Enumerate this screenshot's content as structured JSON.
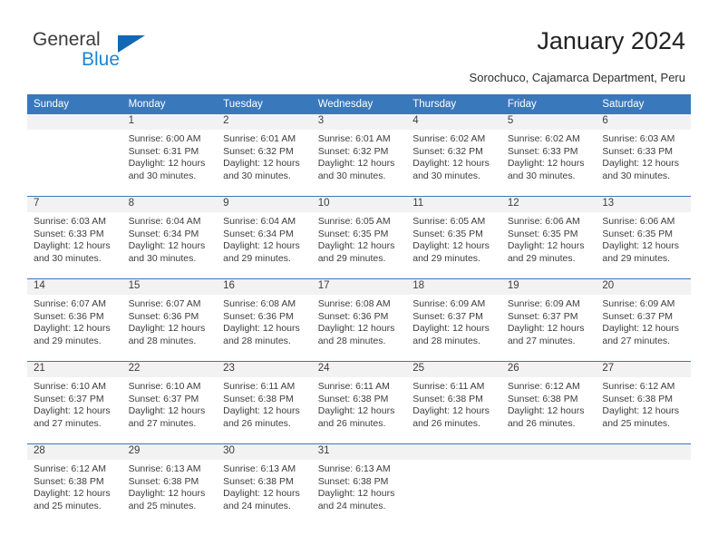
{
  "brand": {
    "name_part1": "General",
    "name_part2": "Blue",
    "triangle_color": "#1268b3",
    "blue_color": "#1c86d6"
  },
  "header": {
    "title": "January 2024",
    "subtitle": "Sorochuco, Cajamarca Department, Peru",
    "header_bg": "#3a78bc"
  },
  "calendar": {
    "weekday_headers": [
      "Sunday",
      "Monday",
      "Tuesday",
      "Wednesday",
      "Thursday",
      "Friday",
      "Saturday"
    ],
    "weeks": [
      [
        {
          "day": "",
          "sunrise": "",
          "sunset": "",
          "daylight": "",
          "daylight2": ""
        },
        {
          "day": "1",
          "sunrise": "Sunrise: 6:00 AM",
          "sunset": "Sunset: 6:31 PM",
          "daylight": "Daylight: 12 hours",
          "daylight2": "and 30 minutes."
        },
        {
          "day": "2",
          "sunrise": "Sunrise: 6:01 AM",
          "sunset": "Sunset: 6:32 PM",
          "daylight": "Daylight: 12 hours",
          "daylight2": "and 30 minutes."
        },
        {
          "day": "3",
          "sunrise": "Sunrise: 6:01 AM",
          "sunset": "Sunset: 6:32 PM",
          "daylight": "Daylight: 12 hours",
          "daylight2": "and 30 minutes."
        },
        {
          "day": "4",
          "sunrise": "Sunrise: 6:02 AM",
          "sunset": "Sunset: 6:32 PM",
          "daylight": "Daylight: 12 hours",
          "daylight2": "and 30 minutes."
        },
        {
          "day": "5",
          "sunrise": "Sunrise: 6:02 AM",
          "sunset": "Sunset: 6:33 PM",
          "daylight": "Daylight: 12 hours",
          "daylight2": "and 30 minutes."
        },
        {
          "day": "6",
          "sunrise": "Sunrise: 6:03 AM",
          "sunset": "Sunset: 6:33 PM",
          "daylight": "Daylight: 12 hours",
          "daylight2": "and 30 minutes."
        }
      ],
      [
        {
          "day": "7",
          "sunrise": "Sunrise: 6:03 AM",
          "sunset": "Sunset: 6:33 PM",
          "daylight": "Daylight: 12 hours",
          "daylight2": "and 30 minutes."
        },
        {
          "day": "8",
          "sunrise": "Sunrise: 6:04 AM",
          "sunset": "Sunset: 6:34 PM",
          "daylight": "Daylight: 12 hours",
          "daylight2": "and 30 minutes."
        },
        {
          "day": "9",
          "sunrise": "Sunrise: 6:04 AM",
          "sunset": "Sunset: 6:34 PM",
          "daylight": "Daylight: 12 hours",
          "daylight2": "and 29 minutes."
        },
        {
          "day": "10",
          "sunrise": "Sunrise: 6:05 AM",
          "sunset": "Sunset: 6:35 PM",
          "daylight": "Daylight: 12 hours",
          "daylight2": "and 29 minutes."
        },
        {
          "day": "11",
          "sunrise": "Sunrise: 6:05 AM",
          "sunset": "Sunset: 6:35 PM",
          "daylight": "Daylight: 12 hours",
          "daylight2": "and 29 minutes."
        },
        {
          "day": "12",
          "sunrise": "Sunrise: 6:06 AM",
          "sunset": "Sunset: 6:35 PM",
          "daylight": "Daylight: 12 hours",
          "daylight2": "and 29 minutes."
        },
        {
          "day": "13",
          "sunrise": "Sunrise: 6:06 AM",
          "sunset": "Sunset: 6:35 PM",
          "daylight": "Daylight: 12 hours",
          "daylight2": "and 29 minutes."
        }
      ],
      [
        {
          "day": "14",
          "sunrise": "Sunrise: 6:07 AM",
          "sunset": "Sunset: 6:36 PM",
          "daylight": "Daylight: 12 hours",
          "daylight2": "and 29 minutes."
        },
        {
          "day": "15",
          "sunrise": "Sunrise: 6:07 AM",
          "sunset": "Sunset: 6:36 PM",
          "daylight": "Daylight: 12 hours",
          "daylight2": "and 28 minutes."
        },
        {
          "day": "16",
          "sunrise": "Sunrise: 6:08 AM",
          "sunset": "Sunset: 6:36 PM",
          "daylight": "Daylight: 12 hours",
          "daylight2": "and 28 minutes."
        },
        {
          "day": "17",
          "sunrise": "Sunrise: 6:08 AM",
          "sunset": "Sunset: 6:36 PM",
          "daylight": "Daylight: 12 hours",
          "daylight2": "and 28 minutes."
        },
        {
          "day": "18",
          "sunrise": "Sunrise: 6:09 AM",
          "sunset": "Sunset: 6:37 PM",
          "daylight": "Daylight: 12 hours",
          "daylight2": "and 28 minutes."
        },
        {
          "day": "19",
          "sunrise": "Sunrise: 6:09 AM",
          "sunset": "Sunset: 6:37 PM",
          "daylight": "Daylight: 12 hours",
          "daylight2": "and 27 minutes."
        },
        {
          "day": "20",
          "sunrise": "Sunrise: 6:09 AM",
          "sunset": "Sunset: 6:37 PM",
          "daylight": "Daylight: 12 hours",
          "daylight2": "and 27 minutes."
        }
      ],
      [
        {
          "day": "21",
          "sunrise": "Sunrise: 6:10 AM",
          "sunset": "Sunset: 6:37 PM",
          "daylight": "Daylight: 12 hours",
          "daylight2": "and 27 minutes."
        },
        {
          "day": "22",
          "sunrise": "Sunrise: 6:10 AM",
          "sunset": "Sunset: 6:37 PM",
          "daylight": "Daylight: 12 hours",
          "daylight2": "and 27 minutes."
        },
        {
          "day": "23",
          "sunrise": "Sunrise: 6:11 AM",
          "sunset": "Sunset: 6:38 PM",
          "daylight": "Daylight: 12 hours",
          "daylight2": "and 26 minutes."
        },
        {
          "day": "24",
          "sunrise": "Sunrise: 6:11 AM",
          "sunset": "Sunset: 6:38 PM",
          "daylight": "Daylight: 12 hours",
          "daylight2": "and 26 minutes."
        },
        {
          "day": "25",
          "sunrise": "Sunrise: 6:11 AM",
          "sunset": "Sunset: 6:38 PM",
          "daylight": "Daylight: 12 hours",
          "daylight2": "and 26 minutes."
        },
        {
          "day": "26",
          "sunrise": "Sunrise: 6:12 AM",
          "sunset": "Sunset: 6:38 PM",
          "daylight": "Daylight: 12 hours",
          "daylight2": "and 26 minutes."
        },
        {
          "day": "27",
          "sunrise": "Sunrise: 6:12 AM",
          "sunset": "Sunset: 6:38 PM",
          "daylight": "Daylight: 12 hours",
          "daylight2": "and 25 minutes."
        }
      ],
      [
        {
          "day": "28",
          "sunrise": "Sunrise: 6:12 AM",
          "sunset": "Sunset: 6:38 PM",
          "daylight": "Daylight: 12 hours",
          "daylight2": "and 25 minutes."
        },
        {
          "day": "29",
          "sunrise": "Sunrise: 6:13 AM",
          "sunset": "Sunset: 6:38 PM",
          "daylight": "Daylight: 12 hours",
          "daylight2": "and 25 minutes."
        },
        {
          "day": "30",
          "sunrise": "Sunrise: 6:13 AM",
          "sunset": "Sunset: 6:38 PM",
          "daylight": "Daylight: 12 hours",
          "daylight2": "and 24 minutes."
        },
        {
          "day": "31",
          "sunrise": "Sunrise: 6:13 AM",
          "sunset": "Sunset: 6:38 PM",
          "daylight": "Daylight: 12 hours",
          "daylight2": "and 24 minutes."
        },
        {
          "day": "",
          "sunrise": "",
          "sunset": "",
          "daylight": "",
          "daylight2": ""
        },
        {
          "day": "",
          "sunrise": "",
          "sunset": "",
          "daylight": "",
          "daylight2": ""
        },
        {
          "day": "",
          "sunrise": "",
          "sunset": "",
          "daylight": "",
          "daylight2": ""
        }
      ]
    ]
  }
}
